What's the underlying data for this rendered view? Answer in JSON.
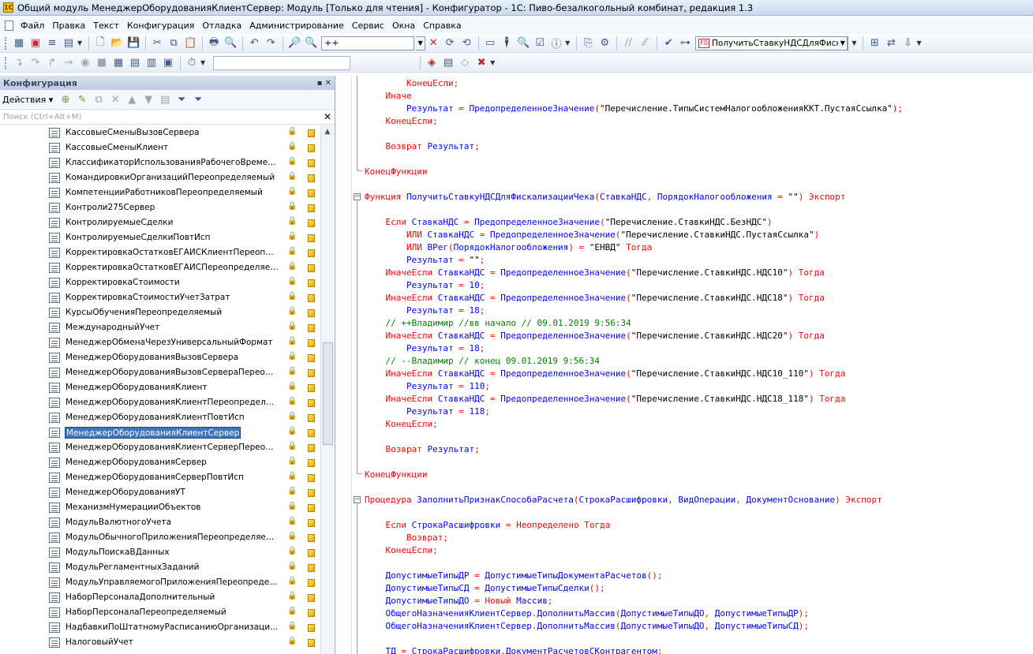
{
  "window": {
    "title": "Общий модуль МенеджерОборудованияКлиентСервер: Модуль [Только для чтения] - Конфигуратор - 1С: Пиво-безалкогольный комбинат, редакция 1.3"
  },
  "menu": [
    "Файл",
    "Правка",
    "Текст",
    "Конфигурация",
    "Отладка",
    "Администрирование",
    "Сервис",
    "Окна",
    "Справка"
  ],
  "toolbar": {
    "search_value": "++",
    "procedure_combo": "ПолучитьСтавкуНДСДляФиска"
  },
  "panel": {
    "title": "Конфигурация",
    "actions_label": "Действия",
    "search_placeholder": "Поиск (Ctrl+Alt+M)",
    "selected_item": "МенеджерОборудованияКлиентСервер",
    "items": [
      "КассовыеСменыВызовСервера",
      "КассовыеСменыКлиент",
      "КлассификаторИспользованияРабочегоВремениП...",
      "КомандировкиОрганизацийПереопределяемый",
      "КомпетенцииРаботниковПереопределяемый",
      "Контроли275Сервер",
      "КонтролируемыеСделки",
      "КонтролируемыеСделкиПовтИсп",
      "КорректировкаОстатковЕГАИСКлиентПереопреде...",
      "КорректировкаОстатковЕГАИСПереопределяемый",
      "КорректировкаСтоимости",
      "КорректировкаСтоимостиУчетЗатрат",
      "КурсыОбученияПереопределяемый",
      "МеждународныйУчет",
      "МенеджерОбменаЧерезУниверсальныйФормат",
      "МенеджерОборудованияВызовСервера",
      "МенеджерОборудованияВызовСервераПереопред...",
      "МенеджерОборудованияКлиент",
      "МенеджерОборудованияКлиентПереопределяемый",
      "МенеджерОборудованияКлиентПовтИсп",
      "МенеджерОборудованияКлиентСервер",
      "МенеджерОборудованияКлиентСерверПереопреде...",
      "МенеджерОборудованияСервер",
      "МенеджерОборудованияСерверПовтИсп",
      "МенеджерОборудованияУТ",
      "МеханизмНумерацииОбъектов",
      "МодульВалютногоУчета",
      "МодульОбычногоПриложенияПереопределяемый",
      "МодульПоискаВДанных",
      "МодульРегламентныхЗаданий",
      "МодульУправляемогоПриложенияПереопределяе...",
      "НаборПерсоналаДополнительный",
      "НаборПерсоналаПереопределяемый",
      "НадбавкиПоШтатномуРасписаниюОрганизацийПе...",
      "НалоговыйУчет"
    ]
  },
  "code": {
    "lines": [
      {
        "y": 2,
        "i": "",
        "t": [
          [
            "kw",
            "КонецЕсли"
          ],
          [
            "",
            "\n"
          ]
        ]
      },
      {
        "y": 18,
        "i": "",
        "t": []
      },
      {
        "y": 34,
        "i": "",
        "t": []
      },
      {
        "y": 50,
        "i": "",
        "t": []
      }
    ]
  },
  "code_text": [
    "        КонецЕсли;",
    "    Иначе",
    "        Результат = ПредопределенноеЗначение(\"Перечисление.ТипыСистемНалогообложенияККТ.ПустаяСсылка\");",
    "    КонецЕсли;",
    "",
    "    Возврат Результат;",
    "",
    "КонецФункции",
    "",
    "Функция ПолучитьСтавкуНДСДляФискализацииЧека(СтавкаНДС, ПорядокНалогообложения = \"\") Экспорт",
    "",
    "    Если СтавкаНДС = ПредопределенноеЗначение(\"Перечисление.СтавкиНДС.БезНДС\")",
    "        ИЛИ СтавкаНДС = ПредопределенноеЗначение(\"Перечисление.СтавкиНДС.ПустаяСсылка\")",
    "        ИЛИ ВРег(ПорядокНалогообложения) = \"ЕНВД\" Тогда",
    "        Результат = \"\";",
    "    ИначеЕсли СтавкаНДС = ПредопределенноеЗначение(\"Перечисление.СтавкиНДС.НДС10\") Тогда",
    "        Результат = 10;",
    "    ИначеЕсли СтавкаНДС = ПредопределенноеЗначение(\"Перечисление.СтавкиНДС.НДС18\") Тогда",
    "        Результат = 18;",
    "    // ++Владимир //вв начало // 09.01.2019 9:56:34",
    "    ИначеЕсли СтавкаНДС = ПредопределенноеЗначение(\"Перечисление.СтавкиНДС.НДС20\") Тогда",
    "        Результат = 18;",
    "    // --Владимир // конец 09.01.2019 9:56:34",
    "    ИначеЕсли СтавкаНДС = ПредопределенноеЗначение(\"Перечисление.СтавкиНДС.НДС10_110\") Тогда",
    "        Результат = 110;",
    "    ИначеЕсли СтавкаНДС = ПредопределенноеЗначение(\"Перечисление.СтавкиНДС.НДС18_118\") Тогда",
    "        Результат = 118;",
    "    КонецЕсли;",
    "",
    "    Возврат Результат;",
    "",
    "КонецФункции",
    "",
    "Процедура ЗаполнитьПризнакСпособаРасчета(СтрокаРасшифровки, ВидОперации, ДокументОснование) Экспорт",
    "",
    "    Если СтрокаРасшифровки = Неопределено Тогда",
    "        Возврат;",
    "    КонецЕсли;",
    "",
    "    ДопустимыеТипыДР = ДопустимыеТипыДокументаРасчетов();",
    "    ДопустимыеТипыСД = ДопустимыеТипыСделки();",
    "    ДопустимыеТипыДО = Новый Массив;",
    "    ОбщегоНазначенияКлиентСервер.ДополнитьМассив(ДопустимыеТипыДО, ДопустимыеТипыДР);",
    "    ОбщегоНазначенияКлиентСервер.ДополнитьМассив(ДопустимыеТипыДО, ДопустимыеТипыСД);",
    "",
    "    ТД = СтрокаРасшифровки.ДокументРасчетовСКонтрагентом;"
  ],
  "colors": {
    "keyword": "#ff0000",
    "identifier": "#0000ff",
    "string": "#000000",
    "comment": "#008000",
    "selection": "#3d74c2"
  }
}
